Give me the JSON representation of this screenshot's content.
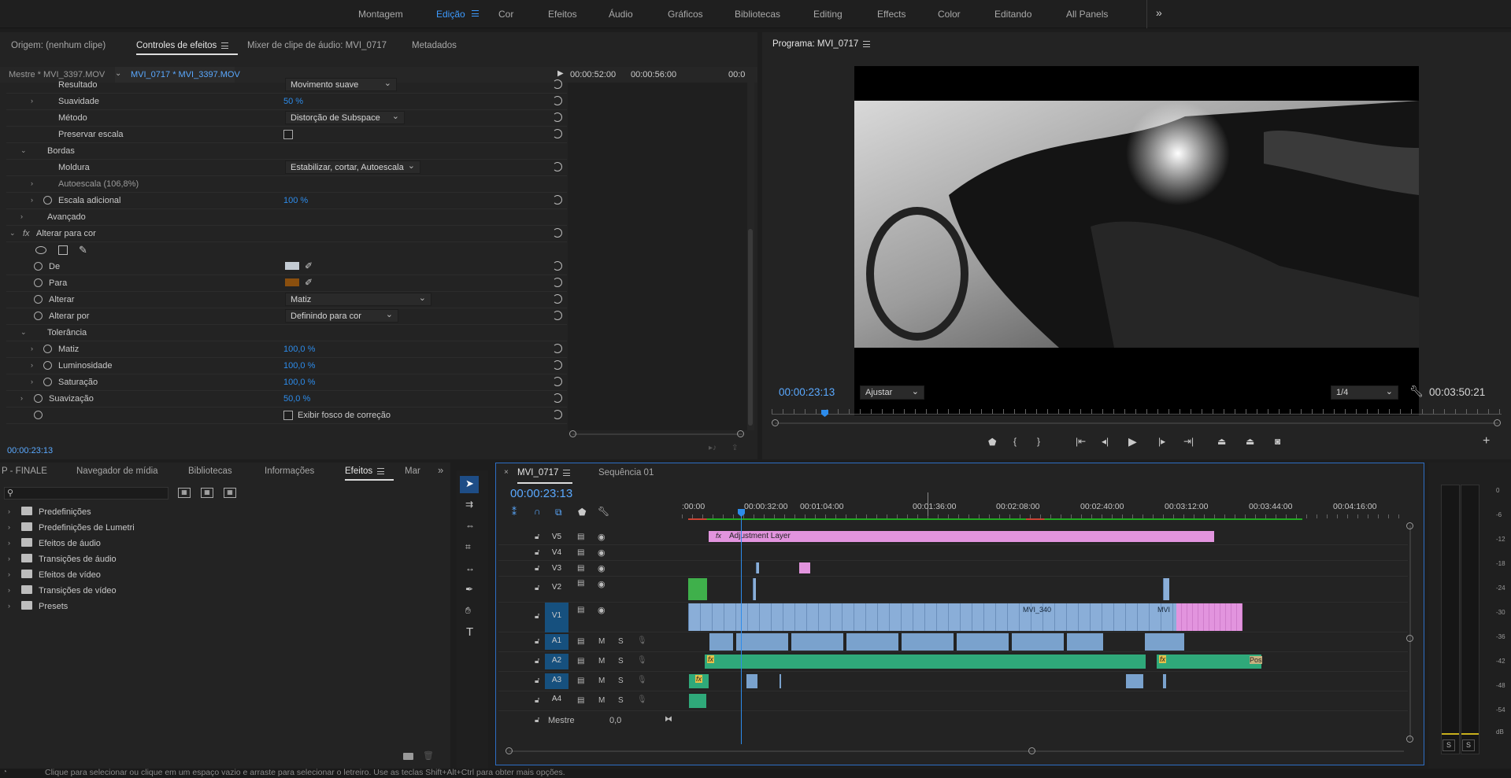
{
  "workspaces": [
    "Montagem",
    "Edição",
    "Cor",
    "Efeitos",
    "Áudio",
    "Gráficos",
    "Bibliotecas",
    "Editing",
    "Effects",
    "Color",
    "Editando",
    "All Panels"
  ],
  "workspace_active": "Edição",
  "effects_panel": {
    "tabs": [
      "Origem: (nenhum clipe)",
      "Controles de efeitos",
      "Mixer de clipe de áudio: MVI_0717",
      "Metadados"
    ],
    "master_label": "Mestre * MVI_3397.MOV",
    "clip_label": "MVI_0717 * MVI_3397.MOV",
    "timecodes": [
      "00:00:52:00",
      "00:00:56:00",
      "00:0"
    ],
    "rows": {
      "resultado": {
        "label": "Resultado",
        "value": "Movimento suave"
      },
      "suavidade": {
        "label": "Suavidade",
        "value": "50 %"
      },
      "metodo": {
        "label": "Método",
        "value": "Distorção de Subspace"
      },
      "preservar": {
        "label": "Preservar escala"
      },
      "bordas": {
        "label": "Bordas"
      },
      "moldura": {
        "label": "Moldura",
        "value": "Estabilizar, cortar, Autoescala"
      },
      "autoescala": {
        "label": "Autoescala (106,8%)"
      },
      "escala": {
        "label": "Escala adicional",
        "value": "100 %"
      },
      "avancado": {
        "label": "Avançado"
      },
      "alterar_cor": {
        "label": "Alterar para cor"
      },
      "de": {
        "label": "De"
      },
      "para": {
        "label": "Para"
      },
      "alterar": {
        "label": "Alterar",
        "value": "Matiz"
      },
      "alterar_por": {
        "label": "Alterar por",
        "value": "Definindo para cor"
      },
      "tolerancia": {
        "label": "Tolerância"
      },
      "matiz": {
        "label": "Matiz",
        "value": "100,0 %"
      },
      "luminosidade": {
        "label": "Luminosidade",
        "value": "100,0 %"
      },
      "saturacao": {
        "label": "Saturação",
        "value": "100,0 %"
      },
      "suavizacao": {
        "label": "Suavização",
        "value": "50,0 %"
      },
      "exibir": {
        "label": "Exibir fosco de correção"
      }
    },
    "current_time": "00:00:23:13",
    "colors": {
      "de": "#c3cbd3",
      "para": "#8a4f0e"
    }
  },
  "program": {
    "title": "Programa: MVI_0717",
    "timecode": "00:00:23:13",
    "fit": "Ajustar",
    "resolution": "1/4",
    "duration": "00:03:50:21"
  },
  "project_panel": {
    "tabs": [
      "P - FINALE",
      "Navegador de mídia",
      "Bibliotecas",
      "Informações",
      "Efeitos",
      "Mar"
    ],
    "items": [
      "Predefinições",
      "Predefinições de Lumetri",
      "Efeitos de áudio",
      "Transições de áudio",
      "Efeitos de vídeo",
      "Transições de vídeo",
      "Presets"
    ]
  },
  "timeline": {
    "tabs": [
      "MVI_0717",
      "Sequência 01"
    ],
    "timecode": "00:00:23:13",
    "ruler": [
      ":00:00",
      "00:00:32:00",
      "00:01:04:00",
      "00:01:36:00",
      "00:02:08:00",
      "00:02:40:00",
      "00:03:12:00",
      "00:03:44:00",
      "00:04:16:00"
    ],
    "video_tracks": [
      "V5",
      "V4",
      "V3",
      "V2",
      "V1"
    ],
    "audio_tracks": [
      "A1",
      "A2",
      "A3",
      "A4"
    ],
    "master": {
      "label": "Mestre",
      "value": "0,0"
    },
    "clip_labels": {
      "adjustment": "Adjustment Layer",
      "mvi_a": "MVI_340",
      "mvi_b": "MVI",
      "pos": "Pos"
    },
    "fx": "fx"
  },
  "meter": {
    "scale": [
      "0",
      "-6",
      "-12",
      "-18",
      "-24",
      "-30",
      "-36",
      "-42",
      "-48",
      "-54",
      "dB"
    ],
    "solo": [
      "S",
      "S"
    ]
  },
  "status": "Clique para selecionar ou clique em um espaço vazio e arraste para selecionar o letreiro. Use as teclas Shift+Alt+Ctrl para obter mais opções."
}
